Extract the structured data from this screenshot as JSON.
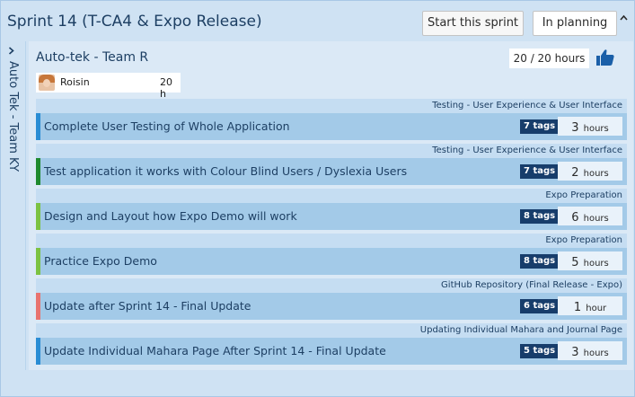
{
  "sprint": {
    "title": "Sprint 14 (T-CA4 & Expo Release)",
    "start_label": "Start this sprint",
    "status_label": "In planning",
    "collapse_icon": "chevron-up-icon"
  },
  "side_tab": {
    "chevron_icon": "chevron-right-icon",
    "label": "Auto Tek - Team KY"
  },
  "team": {
    "name": "Auto-tek - Team R",
    "hours_summary": "20 / 20 hours",
    "thumb_icon": "thumbs-up-icon",
    "member": {
      "name": "Roisin",
      "hours": "20 h"
    }
  },
  "tasks": [
    {
      "category": "Testing - User Experience & User Interface",
      "title": "Complete User Testing of Whole Application",
      "tags": "7 tags",
      "hours": "3",
      "unit": "hours",
      "accent": "#2a8dd4"
    },
    {
      "category": "Testing - User Experience & User Interface",
      "title": "Test application it works with Colour Blind Users / Dyslexia Users",
      "tags": "7 tags",
      "hours": "2",
      "unit": "hours",
      "accent": "#1f8a2e"
    },
    {
      "category": "Expo Preparation",
      "title": "Design and Layout how Expo Demo will work",
      "tags": "8 tags",
      "hours": "6",
      "unit": "hours",
      "accent": "#7cc242"
    },
    {
      "category": "Expo Preparation",
      "title": "Practice Expo Demo",
      "tags": "8 tags",
      "hours": "5",
      "unit": "hours",
      "accent": "#7cc242"
    },
    {
      "category": "GitHub Repository (Final Release - Expo)",
      "title": "Update after Sprint 14 - Final Update",
      "tags": "6 tags",
      "hours": "1",
      "unit": "hour",
      "accent": "#e8736f"
    },
    {
      "category": "Updating Individual Mahara and Journal Page",
      "title": "Update Individual Mahara Page After Sprint 14 - Final Update",
      "tags": "5 tags",
      "hours": "3",
      "unit": "hours",
      "accent": "#2a8dd4"
    }
  ]
}
